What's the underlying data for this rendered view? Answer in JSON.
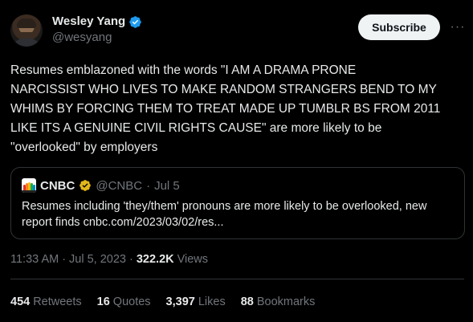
{
  "author": {
    "display_name": "Wesley Yang",
    "handle": "@wesyang",
    "avatar_icon": "person-avatar",
    "verified_color": "#1d9bf0"
  },
  "actions": {
    "subscribe_label": "Subscribe",
    "more_label": "···"
  },
  "tweet": {
    "text": "Resumes emblazoned with the words \"I AM A DRAMA PRONE\nNARCISSIST WHO LIVES TO MAKE RANDOM STRANGERS BEND TO MY\nWHIMS BY FORCING THEM TO TREAT MADE UP TUMBLR BS FROM 2011\nLIKE ITS A GENUINE CIVIL RIGHTS CAUSE\" are more likely to be\n\"overlooked\" by employers"
  },
  "quote": {
    "name": "CNBC",
    "handle": "@CNBC",
    "separator": "·",
    "date": "Jul 5",
    "text": "Resumes including 'they/them' pronouns are more likely to be overlooked, new report finds  cnbc.com/2023/03/02/res...",
    "verified_color": "#e2b719"
  },
  "meta": {
    "time": "11:33 AM",
    "sep1": "·",
    "date": "Jul 5, 2023",
    "sep2": "·",
    "views": "322.2K",
    "views_label": "Views"
  },
  "stats": [
    {
      "count": "454",
      "label": "Retweets"
    },
    {
      "count": "16",
      "label": "Quotes"
    },
    {
      "count": "3,397",
      "label": "Likes"
    },
    {
      "count": "88",
      "label": "Bookmarks"
    }
  ],
  "colors": {
    "background": "#000000",
    "text": "#e7e9ea",
    "muted": "#71767b",
    "border": "#2f3336"
  }
}
